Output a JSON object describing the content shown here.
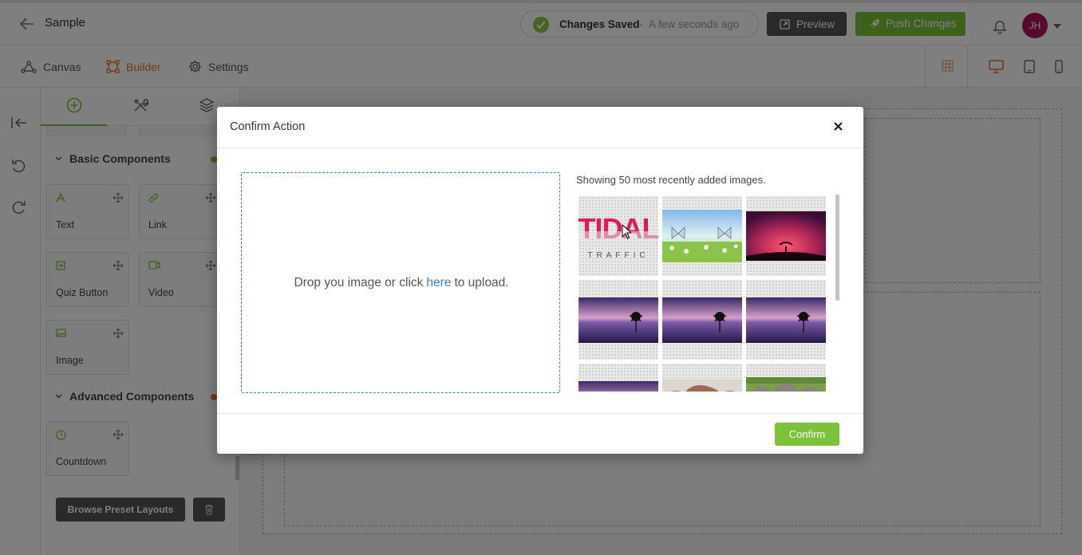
{
  "header": {
    "title": "Sample",
    "save_status": "Changes Saved",
    "save_separator": "-",
    "save_time": "A few seconds ago",
    "preview_label": "Preview",
    "push_label": "Push Changes",
    "avatar_initials": "JH"
  },
  "mode_tabs": {
    "canvas": "Canvas",
    "builder": "Builder",
    "settings": "Settings",
    "active": "Builder"
  },
  "panel": {
    "basic_title": "Basic Components",
    "advanced_title": "Advanced Components",
    "components": {
      "text": "Text",
      "link": "Link",
      "quiz_button": "Quiz Button",
      "video": "Video",
      "image": "Image",
      "countdown": "Countdown"
    },
    "browse_label": "Browse Preset Layouts"
  },
  "modal": {
    "title": "Confirm Action",
    "drop_before": "Drop you image or click",
    "drop_link": "here",
    "drop_after": "to upload.",
    "gallery_caption": "Showing 50 most recently added images.",
    "logo_word": "TIDAL",
    "logo_sub": "TRAFFIC",
    "confirm_label": "Confirm"
  },
  "colors": {
    "accent_green": "#7dc13a",
    "accent_orange": "#e2762b",
    "link_blue": "#3d7cc9",
    "avatar": "#b0125c",
    "dark_button": "#555555"
  },
  "icons": [
    "back-arrow-icon",
    "check-icon",
    "external-link-icon",
    "rocket-icon",
    "bell-icon",
    "chevron-down-icon",
    "canvas-nodes-icon",
    "builder-frame-icon",
    "gear-icon",
    "grid-icon",
    "desktop-icon",
    "tablet-icon",
    "mobile-icon",
    "collapse-left-icon",
    "undo-icon",
    "redo-icon",
    "add-circle-icon",
    "tools-icon",
    "layers-icon",
    "move-icon",
    "trash-icon",
    "close-icon",
    "cursor-icon"
  ]
}
